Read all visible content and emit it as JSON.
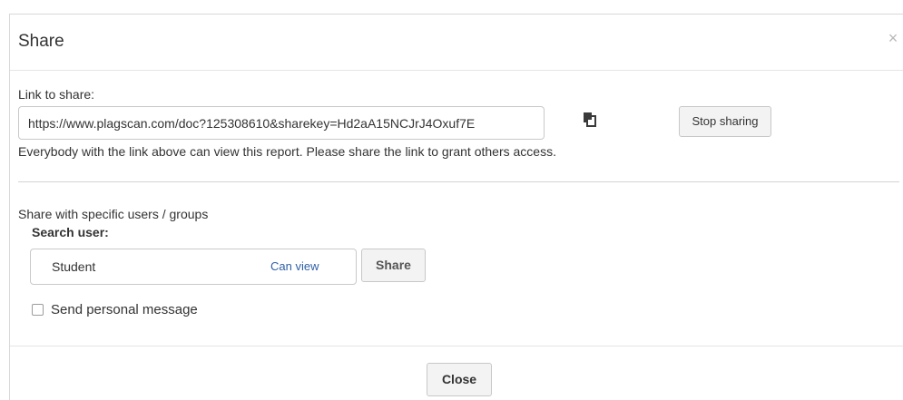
{
  "dialog": {
    "title": "Share",
    "close_glyph": "×"
  },
  "link_section": {
    "label": "Link to share:",
    "url": "https://www.plagscan.com/doc?125308610&sharekey=Hd2aA15NCJrJ4Oxuf7E",
    "copy_icon": "copy-icon",
    "stop_sharing_label": "Stop sharing",
    "info_text": "Everybody with the link above can view this report. Please share the link to grant others access."
  },
  "user_section": {
    "heading": "Share with specific users / groups",
    "search_label": "Search user:",
    "search_value": "Student",
    "permission": "Can view",
    "share_label": "Share",
    "personal_message_label": "Send personal message",
    "personal_message_checked": false
  },
  "footer": {
    "close_label": "Close"
  },
  "colors": {
    "permission_text": "#2f5fa6",
    "caret": "#1a5fd0",
    "button_bg": "#f3f3f3"
  }
}
